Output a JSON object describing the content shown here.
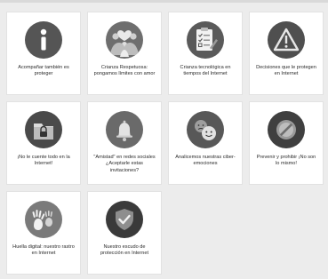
{
  "cards": [
    {
      "label": "Acompañar también es proteger",
      "icon": "info-icon"
    },
    {
      "label": "Crianza Respetuosa: pongamos límites con amor",
      "icon": "family-icon"
    },
    {
      "label": "Crianza tecnológica en tiempos del Internet",
      "icon": "checklist-icon"
    },
    {
      "label": "Decisiones que le protegen en Internet",
      "icon": "warning-icon"
    },
    {
      "label": "¡No le cuente todo en la Internet!",
      "icon": "lock-folder-icon"
    },
    {
      "label": "\"Amistad\" en redes sociales ¿Aceptarle estas invitaciones?",
      "icon": "bell-icon"
    },
    {
      "label": "Analicemos nuestras ciber-emociones",
      "icon": "emotions-icon"
    },
    {
      "label": "Prevenir y prohibir ¡No son lo mismo!",
      "icon": "prohibited-icon"
    },
    {
      "label": "Huella digital: nuestro rastro en Internet",
      "icon": "handprint-icon"
    },
    {
      "label": "Nuestro escudo de protección en Internet",
      "icon": "shield-check-icon"
    }
  ]
}
